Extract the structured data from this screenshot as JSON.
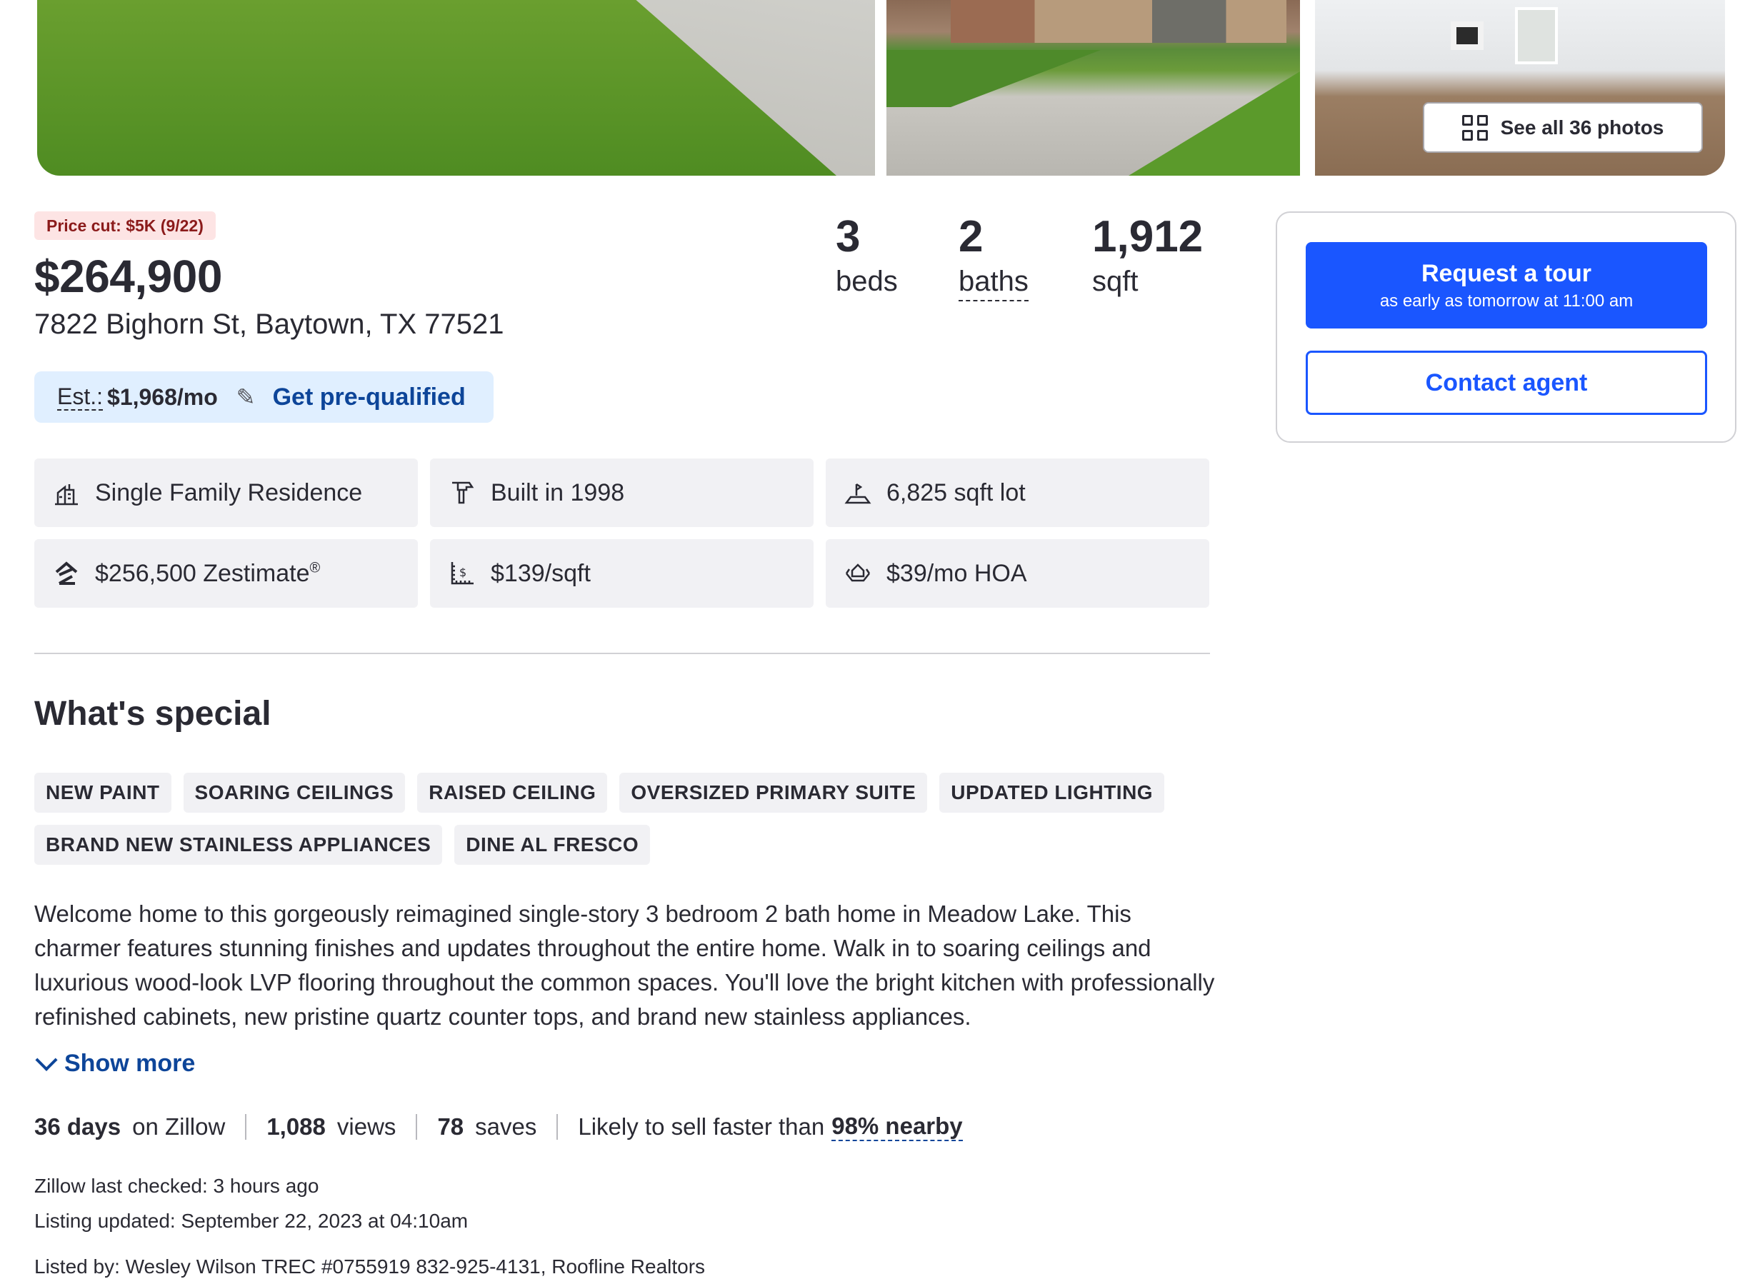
{
  "photos": {
    "see_all_label": "See all 36 photos"
  },
  "summary": {
    "price_cut_badge": "Price cut: $5K (9/22)",
    "price": "$264,900",
    "address": "7822 Bighorn St, Baytown, TX 77521",
    "beds_value": "3",
    "beds_label": "beds",
    "baths_value": "2",
    "baths_label": "baths",
    "sqft_value": "1,912",
    "sqft_label": "sqft"
  },
  "estimate": {
    "label": "Est.:",
    "value": "$1,968/mo",
    "prequal_label": "Get pre-qualified"
  },
  "facts": [
    {
      "icon": "building-icon",
      "text": "Single Family Residence"
    },
    {
      "icon": "hammer-icon",
      "text": "Built in 1998"
    },
    {
      "icon": "lot-icon",
      "text": "6,825 sqft lot"
    },
    {
      "icon": "zestimate-icon",
      "text": "$256,500 Zestimate",
      "sup": "®"
    },
    {
      "icon": "price-sqft-icon",
      "text": "$139/sqft"
    },
    {
      "icon": "hoa-icon",
      "text": "$39/mo HOA"
    }
  ],
  "special": {
    "title": "What's special",
    "chips": [
      "NEW PAINT",
      "SOARING CEILINGS",
      "RAISED CEILING",
      "OVERSIZED PRIMARY SUITE",
      "UPDATED LIGHTING",
      "BRAND NEW STAINLESS APPLIANCES",
      "DINE AL FRESCO"
    ],
    "description": "Welcome home to this gorgeously reimagined single-story 3 bedroom 2 bath home in Meadow Lake.  This charmer features stunning finishes and updates throughout the entire home.  Walk in to soaring ceilings and luxurious wood-look LVP flooring throughout the common spaces.  You'll love the bright kitchen with professionally refinished cabinets, new pristine quartz counter tops, and brand new stainless appliances.",
    "show_more_label": "Show more"
  },
  "stats": {
    "days_value": "36 days",
    "days_label": "on Zillow",
    "views_value": "1,088",
    "views_label": "views",
    "saves_value": "78",
    "saves_label": "saves",
    "sell_text": "Likely to sell faster than",
    "sell_value": "98% nearby"
  },
  "meta": {
    "last_checked": "Zillow last checked: 3 hours ago",
    "listing_updated": "Listing updated: September 22, 2023 at 04:10am",
    "listed_by": "Listed by: Wesley Wilson TREC #0755919 832-925-4131, Roofline Realtors"
  },
  "side_card": {
    "tour_label": "Request a tour",
    "tour_sub": "as early as tomorrow at 11:00 am",
    "contact_label": "Contact agent"
  },
  "colors": {
    "primary_blue": "#1a56ff",
    "link_blue": "#0d4599",
    "badge_bg": "#fde4e4",
    "badge_text": "#8b1b1b",
    "estimate_bg": "#e0efff",
    "chip_bg": "#f1f1f4"
  }
}
